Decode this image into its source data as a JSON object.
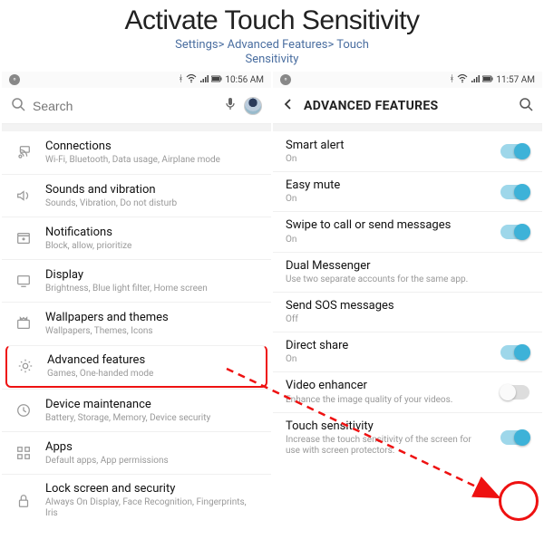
{
  "header": {
    "title": "Activate Touch Sensitivity",
    "breadcrumb_line1": "Settings> Advanced Features> Touch",
    "breadcrumb_line2": "Sensitivity"
  },
  "left": {
    "status_time": "10:56 AM",
    "search_placeholder": "Search",
    "items": [
      {
        "icon": "connections-icon",
        "title": "Connections",
        "sub": "Wi-Fi, Bluetooth, Data usage, Airplane mode"
      },
      {
        "icon": "sound-icon",
        "title": "Sounds and vibration",
        "sub": "Sounds, Vibration, Do not disturb"
      },
      {
        "icon": "notifications-icon",
        "title": "Notifications",
        "sub": "Block, allow, prioritize"
      },
      {
        "icon": "display-icon",
        "title": "Display",
        "sub": "Brightness, Blue light filter, Home screen"
      },
      {
        "icon": "wallpaper-icon",
        "title": "Wallpapers and themes",
        "sub": "Wallpapers, Themes, Icons"
      },
      {
        "icon": "advanced-icon",
        "title": "Advanced features",
        "sub": "Games, One-handed mode",
        "highlight": true
      },
      {
        "icon": "device-maint-icon",
        "title": "Device maintenance",
        "sub": "Battery, Storage, Memory, Device security"
      },
      {
        "icon": "apps-icon",
        "title": "Apps",
        "sub": "Default apps, App permissions"
      },
      {
        "icon": "lock-icon",
        "title": "Lock screen and security",
        "sub": "Always On Display, Face Recognition, Fingerprints, Iris"
      }
    ]
  },
  "right": {
    "status_time": "11:57 AM",
    "header_title": "ADVANCED FEATURES",
    "items": [
      {
        "title": "Smart alert",
        "sub": "On",
        "toggle": "on"
      },
      {
        "title": "Easy mute",
        "sub": "On",
        "toggle": "on"
      },
      {
        "title": "Swipe to call or send messages",
        "sub": "On",
        "toggle": "on"
      },
      {
        "title": "Dual Messenger",
        "sub": "Use two separate accounts for the same app.",
        "toggle": null
      },
      {
        "title": "Send SOS messages",
        "sub": "Off",
        "toggle": null
      },
      {
        "title": "Direct share",
        "sub": "On",
        "toggle": "on"
      },
      {
        "title": "Video enhancer",
        "sub": "Enhance the image quality of your videos.",
        "toggle": "off"
      },
      {
        "title": "Touch sensitivity",
        "sub": "Increase the touch sensitivity of the screen for use with screen protectors.",
        "toggle": "on",
        "circled": true
      }
    ]
  },
  "colors": {
    "accent_red": "#e11",
    "toggle_on": "#3db2d8",
    "breadcrumb": "#4a6ea0"
  }
}
